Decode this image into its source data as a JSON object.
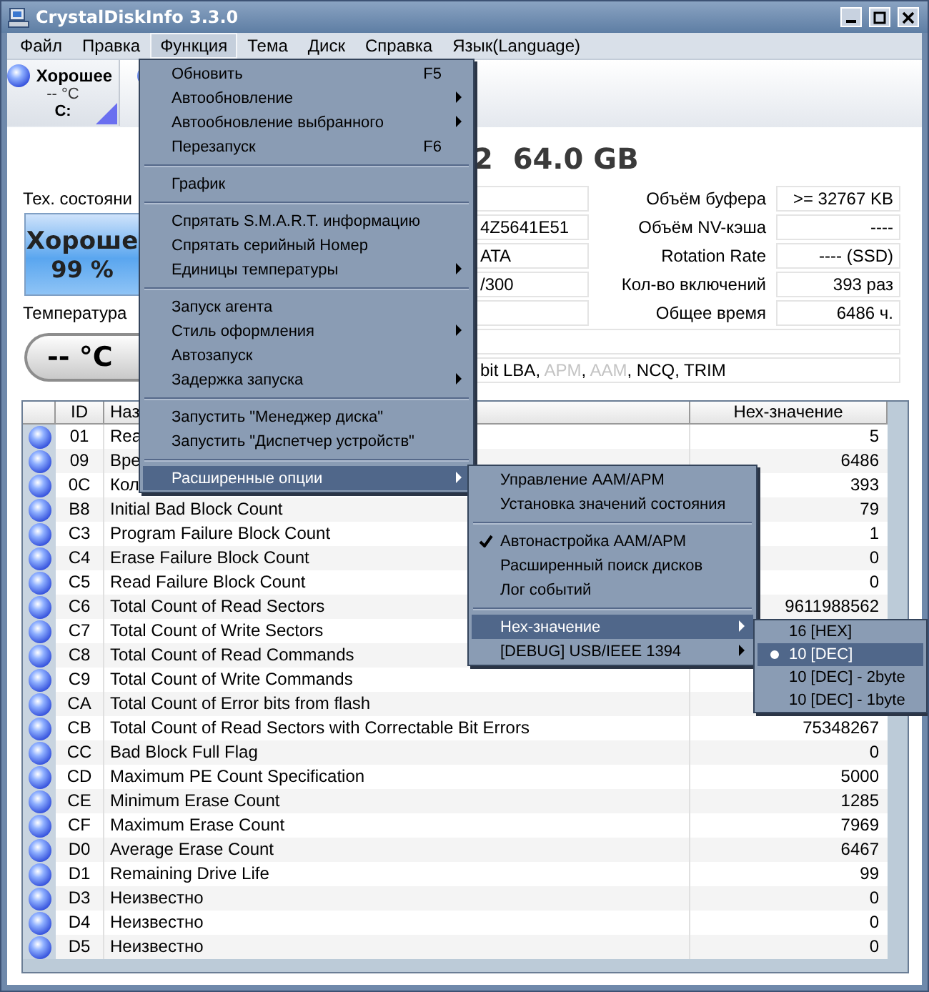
{
  "window": {
    "title": "CrystalDiskInfo 3.3.0"
  },
  "menu_bar": [
    {
      "label": "Файл",
      "selected": false
    },
    {
      "label": "Правка",
      "selected": false
    },
    {
      "label": "Функция",
      "selected": true
    },
    {
      "label": "Тема",
      "selected": false
    },
    {
      "label": "Диск",
      "selected": false
    },
    {
      "label": "Справка",
      "selected": false
    },
    {
      "label": "Язык(Language)",
      "selected": false
    }
  ],
  "disk_button": {
    "status": "Хорошее",
    "temperature": "-- °C",
    "drive": "C:"
  },
  "model": {
    "title": "2  64.0 GB"
  },
  "health": {
    "label": "Тех. состояни",
    "status": "Хороше",
    "percent": "99 %"
  },
  "temperature": {
    "label": "Температура",
    "value": "-- °C"
  },
  "info_left": [
    {
      "kind": "empty"
    },
    {
      "kind": "text",
      "value": "4Z5641E51"
    },
    {
      "kind": "text",
      "value": "ATA"
    },
    {
      "kind": "text",
      "value": "/300"
    },
    {
      "kind": "empty"
    }
  ],
  "info_right": [
    {
      "label": "Объём буфера",
      "value": ">= 32767 KB"
    },
    {
      "label": "Объём NV-кэша",
      "value": "----"
    },
    {
      "label": "Rotation Rate",
      "value": "---- (SSD)"
    },
    {
      "label": "Кол-во включений",
      "value": "393 раз"
    },
    {
      "label": "Общее время",
      "value": "6486 ч."
    }
  ],
  "features": [
    {
      "text": "bit LBA, ",
      "enabled": true
    },
    {
      "text": "APM",
      "enabled": false
    },
    {
      "text": ", ",
      "enabled": true
    },
    {
      "text": "AAM",
      "enabled": false
    },
    {
      "text": ", NCQ, TRIM",
      "enabled": true
    }
  ],
  "table": {
    "columns": [
      "ID",
      "Наз",
      "Нех-значение"
    ],
    "rows": [
      {
        "id": "01",
        "name": "Rea",
        "value": "5"
      },
      {
        "id": "09",
        "name": "Вре",
        "value": "6486"
      },
      {
        "id": "0C",
        "name": "Кол",
        "value": "393"
      },
      {
        "id": "B8",
        "name": "Initial Bad Block Count",
        "value": "79"
      },
      {
        "id": "C3",
        "name": "Program Failure Block Count",
        "value": "1"
      },
      {
        "id": "C4",
        "name": "Erase Failure Block Count",
        "value": "0"
      },
      {
        "id": "C5",
        "name": "Read Failure Block Count",
        "value": "0"
      },
      {
        "id": "C6",
        "name": "Total Count of Read Sectors",
        "value": "9611988562"
      },
      {
        "id": "C7",
        "name": "Total Count of Write Sectors"
      },
      {
        "id": "C8",
        "name": "Total Count of Read Commands"
      },
      {
        "id": "C9",
        "name": "Total Count of Write Commands"
      },
      {
        "id": "CA",
        "name": "Total Count of Error bits from flash"
      },
      {
        "id": "CB",
        "name": "Total Count of Read Sectors with Correctable Bit Errors",
        "value": "75348267"
      },
      {
        "id": "CC",
        "name": "Bad Block Full Flag",
        "value": "0"
      },
      {
        "id": "CD",
        "name": "Maximum PE Count Specification",
        "value": "5000"
      },
      {
        "id": "CE",
        "name": "Minimum Erase Count",
        "value": "1285"
      },
      {
        "id": "CF",
        "name": "Maximum Erase Count",
        "value": "7969"
      },
      {
        "id": "D0",
        "name": "Average Erase Count",
        "value": "6467"
      },
      {
        "id": "D1",
        "name": "Remaining Drive Life",
        "value": "99"
      },
      {
        "id": "D3",
        "name": "Неизвестно",
        "value": "0"
      },
      {
        "id": "D4",
        "name": "Неизвестно",
        "value": "0"
      },
      {
        "id": "D5",
        "name": "Неизвестно",
        "value": "0"
      }
    ]
  },
  "menus": [
    {
      "items": [
        {
          "kind": "item",
          "label": "Обновить",
          "shortcut": "F5",
          "submenu": false,
          "highlighted": false
        },
        {
          "kind": "item",
          "label": "Автообновление",
          "submenu": true,
          "highlighted": false
        },
        {
          "kind": "item",
          "label": "Автообновление выбранного",
          "submenu": true,
          "highlighted": false
        },
        {
          "kind": "item",
          "label": "Перезапуск",
          "shortcut": "F6",
          "submenu": false,
          "highlighted": false
        },
        {
          "kind": "separator"
        },
        {
          "kind": "item",
          "label": "График",
          "submenu": false,
          "highlighted": false
        },
        {
          "kind": "separator"
        },
        {
          "kind": "item",
          "label": "Спрятать S.M.A.R.T. информацию",
          "submenu": false,
          "highlighted": false
        },
        {
          "kind": "item",
          "label": "Спрятать серийный Номер",
          "submenu": false,
          "highlighted": false
        },
        {
          "kind": "item",
          "label": "Единицы температуры",
          "submenu": true,
          "highlighted": false
        },
        {
          "kind": "separator"
        },
        {
          "kind": "item",
          "label": "Запуск агента",
          "submenu": false,
          "highlighted": false
        },
        {
          "kind": "item",
          "label": "Стиль оформления",
          "submenu": true,
          "highlighted": false
        },
        {
          "kind": "item",
          "label": "Автозапуск",
          "submenu": false,
          "highlighted": false
        },
        {
          "kind": "item",
          "label": "Задержка запуска",
          "submenu": true,
          "highlighted": false
        },
        {
          "kind": "separator"
        },
        {
          "kind": "item",
          "label": "Запустить \"Менеджер диска\"",
          "submenu": false,
          "highlighted": false
        },
        {
          "kind": "item",
          "label": "Запустить \"Диспетчер устройств\"",
          "submenu": false,
          "highlighted": false
        },
        {
          "kind": "separator"
        },
        {
          "kind": "item",
          "label": "Расширенные опции",
          "submenu": true,
          "highlighted": true
        }
      ]
    },
    {
      "items": [
        {
          "kind": "item",
          "label": "Управление AAM/APM",
          "submenu": false,
          "checked": false,
          "highlighted": false
        },
        {
          "kind": "item",
          "label": "Установка значений состояния",
          "submenu": false,
          "checked": false,
          "highlighted": false
        },
        {
          "kind": "separator"
        },
        {
          "kind": "item",
          "label": "Автонастройка AAM/APM",
          "submenu": false,
          "checked": true,
          "highlighted": false
        },
        {
          "kind": "item",
          "label": "Расширенный поиск дисков",
          "submenu": false,
          "checked": false,
          "highlighted": false
        },
        {
          "kind": "item",
          "label": "Лог событий",
          "submenu": false,
          "checked": false,
          "highlighted": false
        },
        {
          "kind": "separator"
        },
        {
          "kind": "item",
          "label": "Нех-значение",
          "submenu": true,
          "checked": false,
          "highlighted": true
        },
        {
          "kind": "item",
          "label": "[DEBUG] USB/IEEE 1394",
          "submenu": true,
          "checked": false,
          "highlighted": false
        }
      ]
    },
    {
      "items": [
        {
          "kind": "item",
          "label": "16 [HEX]",
          "selected": false,
          "highlighted": false
        },
        {
          "kind": "item",
          "label": "10 [DEC]",
          "selected": true,
          "highlighted": true
        },
        {
          "kind": "item",
          "label": "10 [DEC] - 2byte",
          "selected": false,
          "highlighted": false
        },
        {
          "kind": "item",
          "label": "10 [DEC] - 1byte",
          "selected": false,
          "highlighted": false
        }
      ]
    }
  ]
}
